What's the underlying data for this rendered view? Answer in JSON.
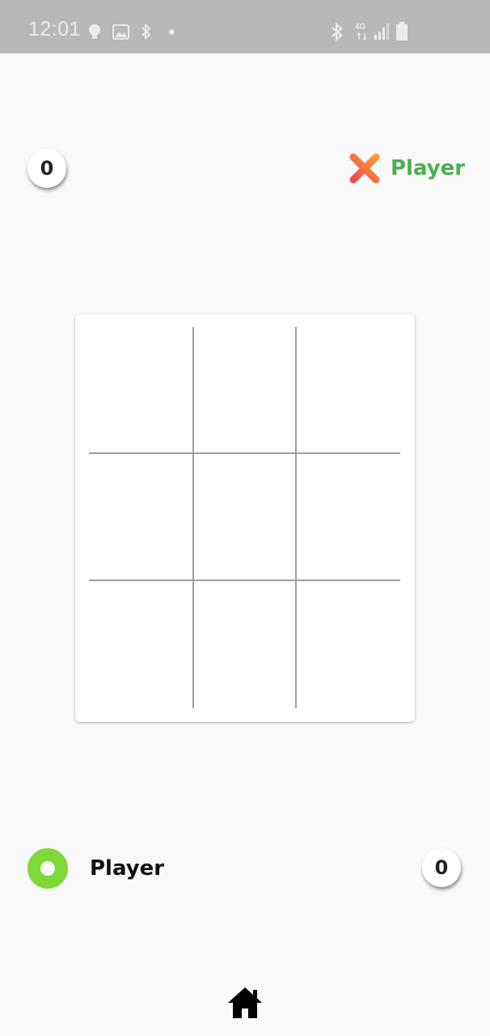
{
  "status_bar": {
    "time": "12:01",
    "left_icons": [
      "lightbulb-icon",
      "image-icon",
      "bluetooth-icon",
      "dot-icon"
    ],
    "right_icons": [
      "bluetooth-icon",
      "4g-icon",
      "signal-icon",
      "battery-icon"
    ],
    "network_label": "4G"
  },
  "top_player": {
    "score": "0",
    "mark": "x-icon",
    "name": "Player",
    "name_color": "#4caf50",
    "mark_colors": [
      "#f06a3a",
      "#ff9a2e"
    ]
  },
  "bottom_player": {
    "score": "0",
    "mark": "o-icon",
    "name": "Player",
    "name_color": "#111111",
    "mark_color": "#7ed83a"
  },
  "board": {
    "rows": 3,
    "cols": 3,
    "cells": [
      "",
      "",
      "",
      "",
      "",
      "",
      "",
      "",
      ""
    ]
  },
  "nav": {
    "home_icon": "home-icon"
  }
}
